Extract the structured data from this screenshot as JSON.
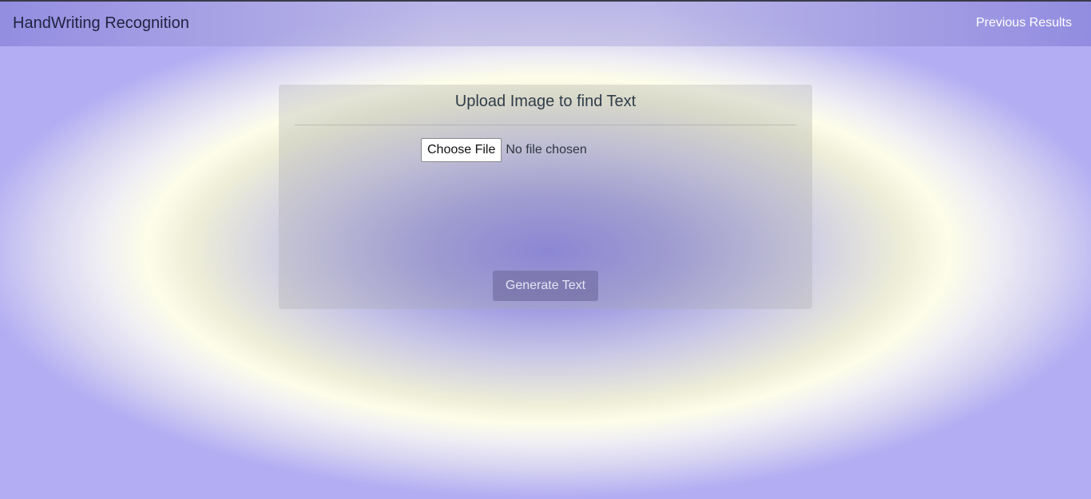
{
  "navbar": {
    "brand": "HandWriting Recognition",
    "link": "Previous Results"
  },
  "upload": {
    "title": "Upload Image to find Text",
    "choose_file_label": "Choose File",
    "file_status": "No file chosen",
    "generate_label": "Generate Text"
  },
  "colors": {
    "background_center": "#7f78e6",
    "background_ring": "#fdfde9",
    "background_edge": "#8f87f5",
    "button": "#7a76ac",
    "nav_link": "#ffffff"
  }
}
